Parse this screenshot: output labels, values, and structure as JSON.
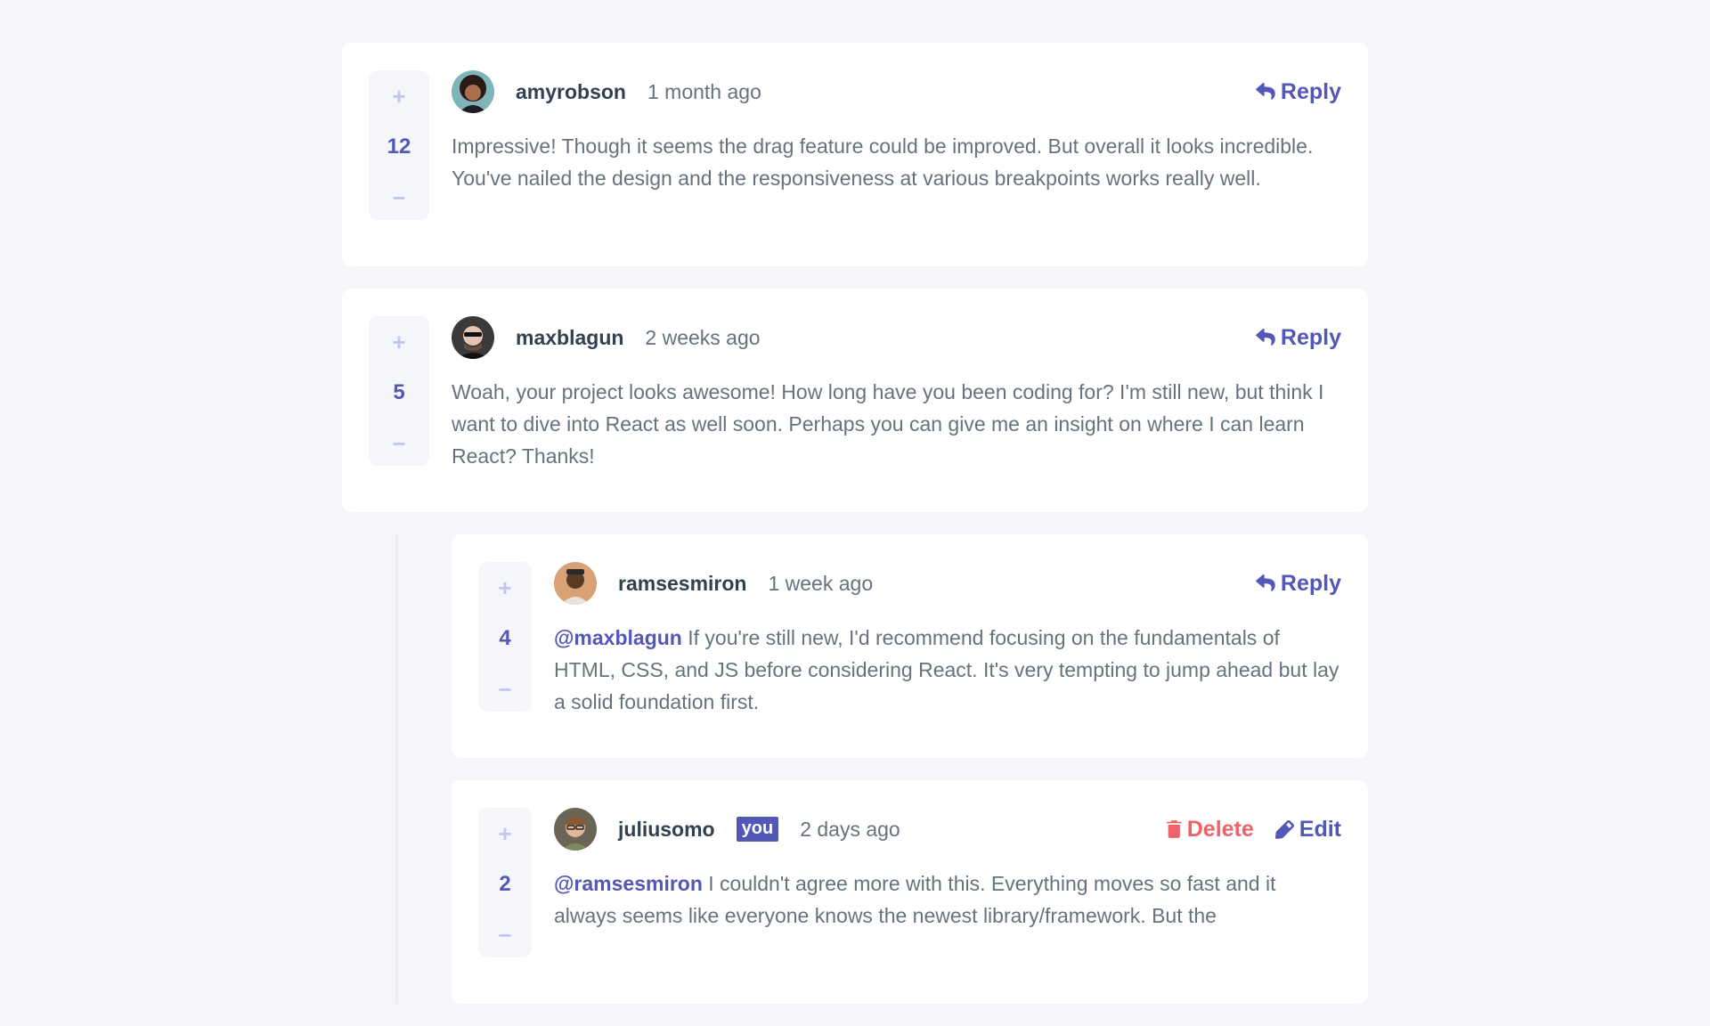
{
  "comments": [
    {
      "username": "amyrobson",
      "time": "1 month ago",
      "score": "12",
      "text": "Impressive! Though it seems the drag feature could be improved. But overall it looks incredible. You've nailed the design and the responsiveness at various breakpoints works really well.",
      "reply_label": "Reply"
    },
    {
      "username": "maxblagun",
      "time": "2 weeks ago",
      "score": "5",
      "text": "Woah, your project looks awesome! How long have you been coding for? I'm still new, but think I want to dive into React as well soon. Perhaps you can give me an insight on where I can learn React? Thanks!",
      "reply_label": "Reply"
    }
  ],
  "replies": [
    {
      "username": "ramsesmiron",
      "time": "1 week ago",
      "score": "4",
      "mention": "@maxblagun",
      "text": "If you're still new, I'd recommend focusing on the fundamentals of HTML, CSS, and JS before considering React. It's very tempting to jump ahead but lay a solid foundation first.",
      "reply_label": "Reply"
    },
    {
      "username": "juliusomo",
      "you_badge": "you",
      "time": "2 days ago",
      "score": "2",
      "mention": "@ramsesmiron",
      "text": "I couldn't agree more with this. Everything moves so fast and it always seems like everyone knows the newest library/framework. But the",
      "delete_label": "Delete",
      "edit_label": "Edit"
    }
  ],
  "vote": {
    "plus": "+",
    "minus": "−"
  },
  "colors": {
    "background": "#f5f6fa",
    "card": "#ffffff",
    "primary": "#5357b6",
    "vote_icon": "#c5c6ef",
    "danger": "#ed6368",
    "username": "#324152",
    "text": "#67727e"
  },
  "icons": {
    "reply": "reply-icon",
    "delete": "trash-icon",
    "edit": "pencil-icon"
  }
}
